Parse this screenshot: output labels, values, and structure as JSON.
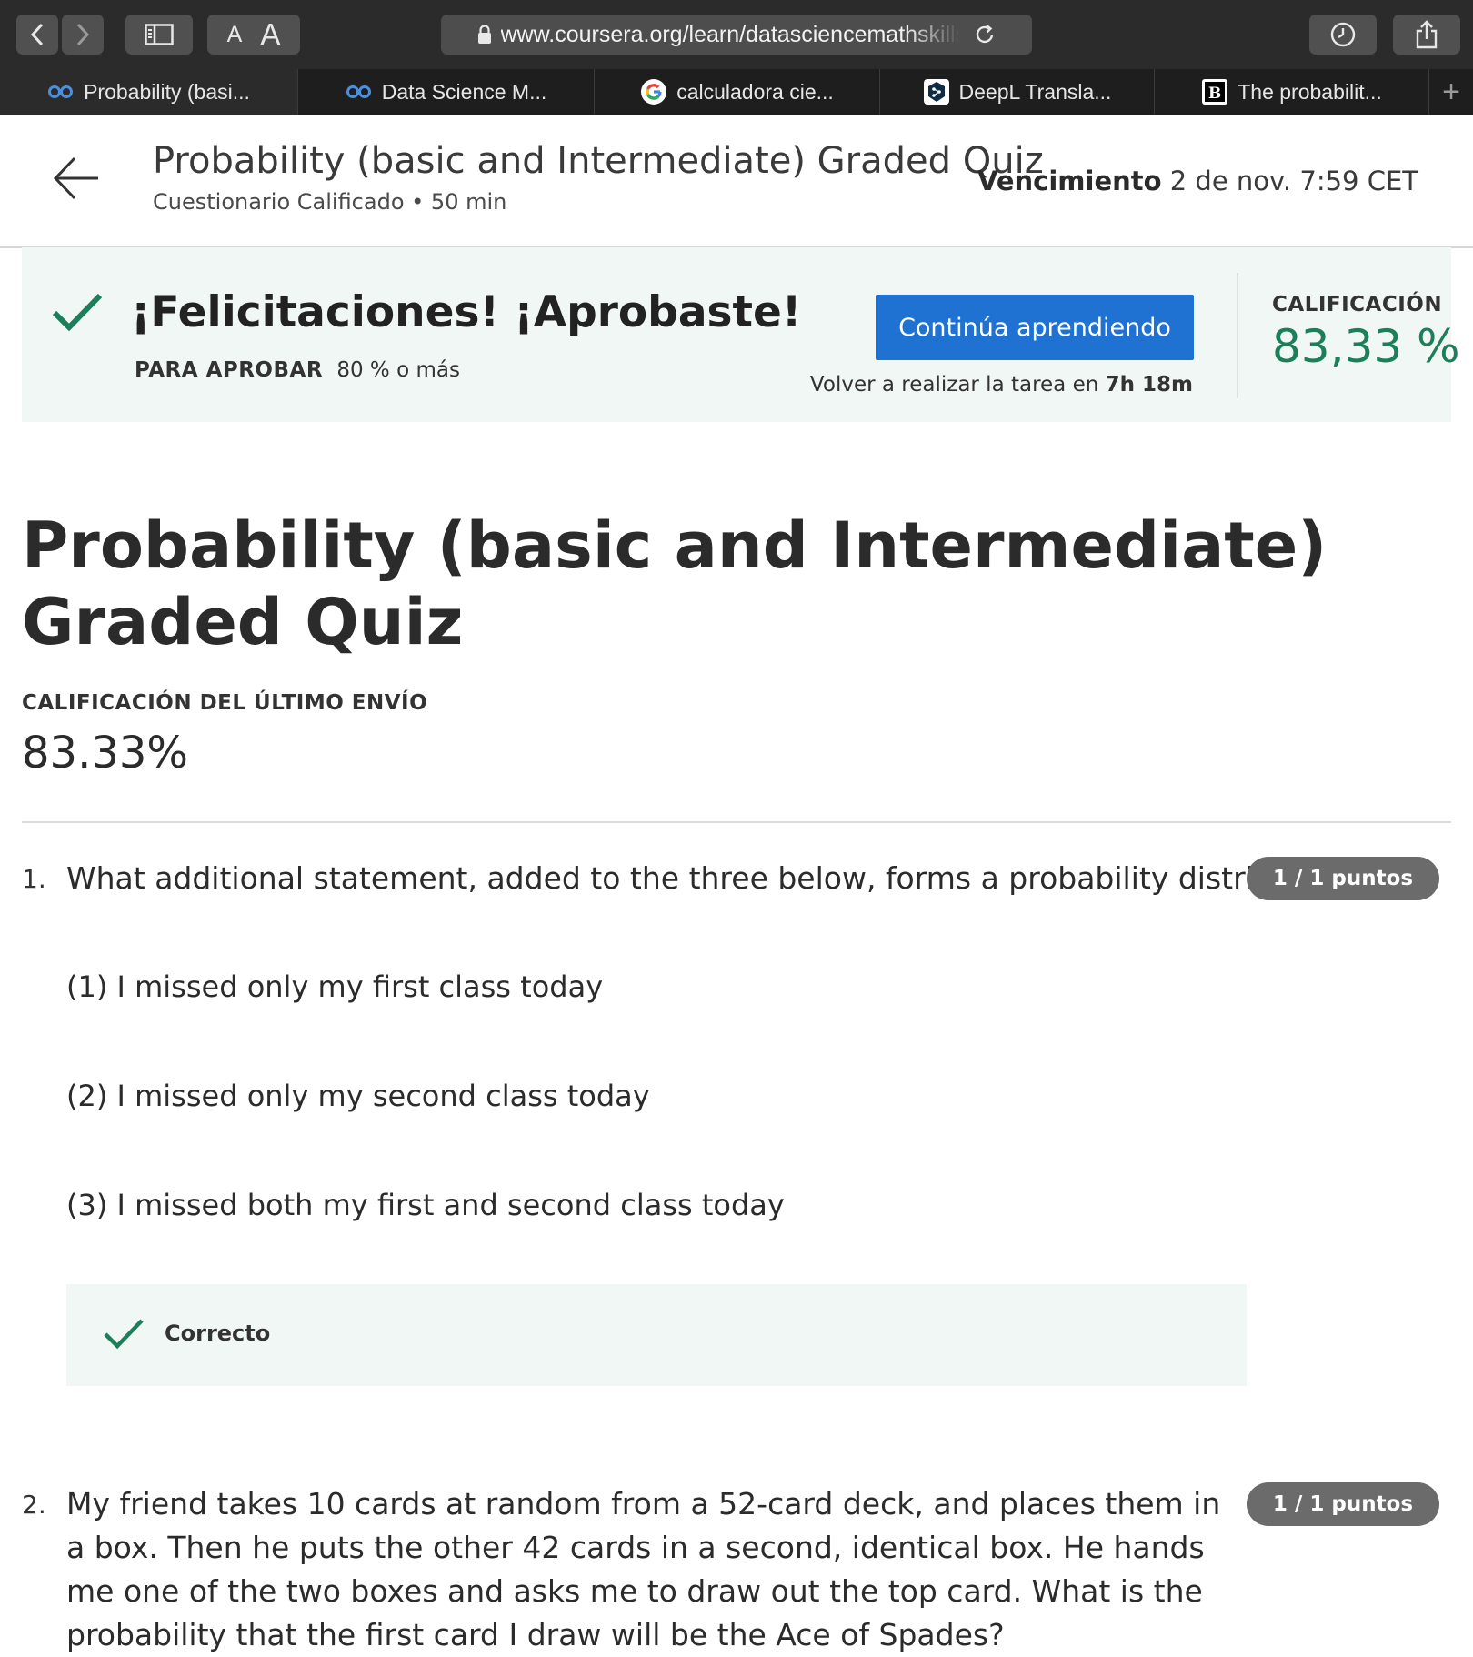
{
  "browser": {
    "url": "www.coursera.org/learn/datasciencemathskills",
    "text_size_small": "A",
    "text_size_large": "A",
    "tabs": [
      {
        "label": "Probability (basi...",
        "icon": "coursera-icon",
        "active": true
      },
      {
        "label": "Data Science M...",
        "icon": "coursera-icon",
        "active": false
      },
      {
        "label": "calculadora cie...",
        "icon": "google-icon",
        "active": false
      },
      {
        "label": "DeepL Transla...",
        "icon": "deepl-icon",
        "active": false
      },
      {
        "label": "The probabilit...",
        "icon": "brainly-icon",
        "active": false
      }
    ],
    "new_tab_label": "+"
  },
  "header": {
    "title": "Probability (basic and Intermediate) Graded Quiz",
    "subtitle": "Cuestionario Calificado • 50 min",
    "due_label": "Vencimiento",
    "due_value": "2 de nov. 7:59 CET"
  },
  "banner": {
    "title": "¡Felicitaciones! ¡Aprobaste!",
    "pass_label": "PARA APROBAR",
    "pass_value": "80 % o más",
    "continue_button": "Continúa aprendiendo",
    "retake_text": "Volver a realizar la tarea en",
    "retake_time": "7h 18m",
    "grade_label": "CALIFICACIÓN",
    "grade_value": "83,33 %",
    "accent_color": "#1d7f5a",
    "button_color": "#1f72d1"
  },
  "main": {
    "title": "Probability (basic and Intermediate) Graded Quiz",
    "last_submission_label": "CALIFICACIÓN DEL ÚLTIMO ENVÍO",
    "last_submission_value": "83.33%"
  },
  "questions": [
    {
      "number": "1.",
      "text": "What additional statement, added to the three below, forms a probability distribution?",
      "points": "1 / 1 puntos",
      "options": [
        "(1) I missed only my first class today",
        "(2) I missed only my second class today",
        "(3) I missed both my first and second class today"
      ],
      "feedback": "Correcto"
    },
    {
      "number": "2.",
      "text": "My friend takes 10 cards at random from a 52-card deck, and places them in a box. Then he puts the other 42 cards in a second, identical box. He hands me one of the two boxes and asks me to draw out the top card. What is the probability that the first card I draw will be the Ace of Spades?",
      "points": "1 / 1 puntos"
    }
  ]
}
